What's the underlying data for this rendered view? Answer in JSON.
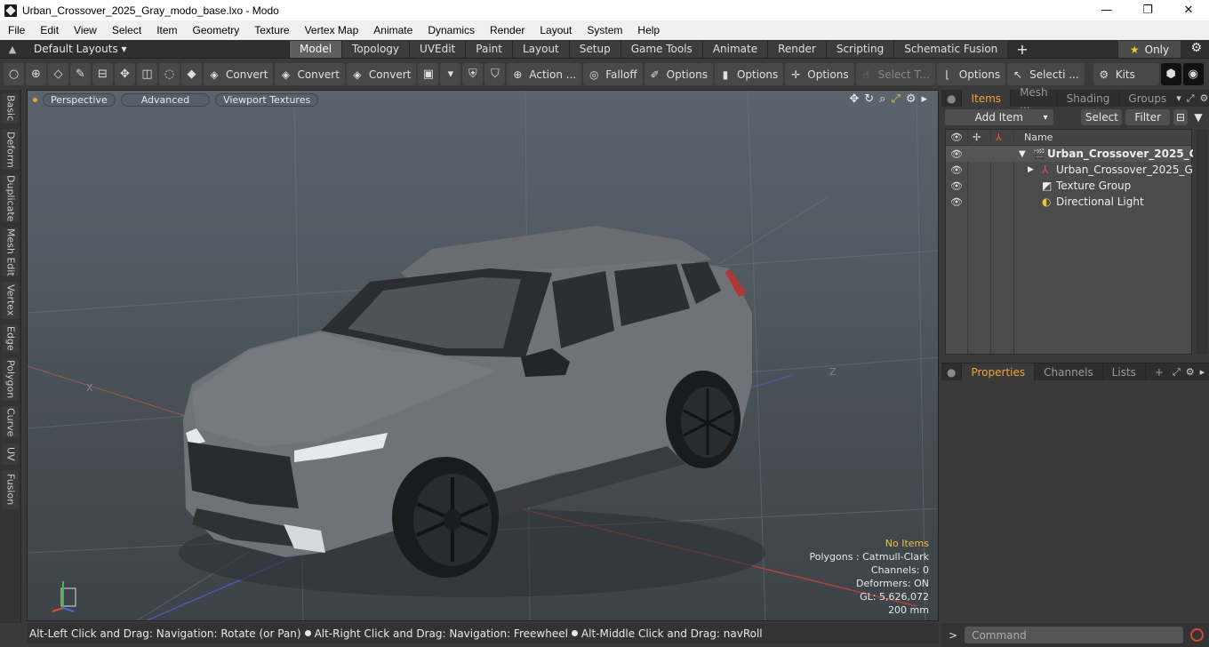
{
  "window": {
    "title": "Urban_Crossover_2025_Gray_modo_base.lxo - Modo",
    "minimize": "—",
    "maximize": "❐",
    "close": "✕"
  },
  "menu": [
    "File",
    "Edit",
    "View",
    "Select",
    "Item",
    "Geometry",
    "Texture",
    "Vertex Map",
    "Animate",
    "Dynamics",
    "Render",
    "Layout",
    "System",
    "Help"
  ],
  "layoutbar": {
    "layouts_label": "Default Layouts ▾",
    "tabs": [
      "Model",
      "Topology",
      "UVEdit",
      "Paint",
      "Layout",
      "Setup",
      "Game Tools",
      "Animate",
      "Render",
      "Scripting",
      "Schematic Fusion"
    ],
    "active_tab": "Model",
    "only_label": "Only"
  },
  "toolbar": {
    "convert1": "Convert",
    "convert2": "Convert",
    "convert3": "Convert",
    "action": "Action ...",
    "falloff": "Falloff",
    "options1": "Options",
    "options2": "Options",
    "options3": "Options",
    "select_t": "Select T...",
    "options4": "Options",
    "selecti": "Selecti ...",
    "kits": "Kits"
  },
  "lefttabs": [
    "Basic",
    "Deform",
    "Duplicate",
    "Mesh Edit",
    "Vertex",
    "Edge",
    "Polygon",
    "Curve",
    "UV",
    "Fusion"
  ],
  "viewport": {
    "view": "Perspective",
    "shading": "Advanced",
    "textures": "Viewport Textures",
    "axis_x": "X",
    "axis_z": "Z",
    "stats": {
      "no_items": "No Items",
      "polygons": "Polygons : Catmull-Clark",
      "channels": "Channels: 0",
      "deformers": "Deformers: ON",
      "gl": "GL: 5,626,072",
      "scale": "200 mm"
    }
  },
  "statusbar": {
    "hint1": "Alt-Left Click and Drag: Navigation: Rotate (or Pan)",
    "hint2": "Alt-Right Click and Drag: Navigation: Freewheel",
    "hint3": "Alt-Middle Click and Drag: navRoll"
  },
  "items_panel": {
    "tabs": [
      "Items",
      "Mesh ...",
      "Shading",
      "Groups"
    ],
    "add_item": "Add Item",
    "select": "Select",
    "filter": "Filter",
    "name_col": "Name",
    "rows": [
      {
        "label": "Urban_Crossover_2025_G..."
      },
      {
        "label": "Urban_Crossover_2025_Gra..."
      },
      {
        "label": "Texture Group"
      },
      {
        "label": "Directional Light"
      }
    ]
  },
  "props_panel": {
    "tabs": [
      "Properties",
      "Channels",
      "Lists"
    ],
    "add": "+"
  },
  "command": {
    "placeholder": "Command",
    "prompt": ">"
  }
}
